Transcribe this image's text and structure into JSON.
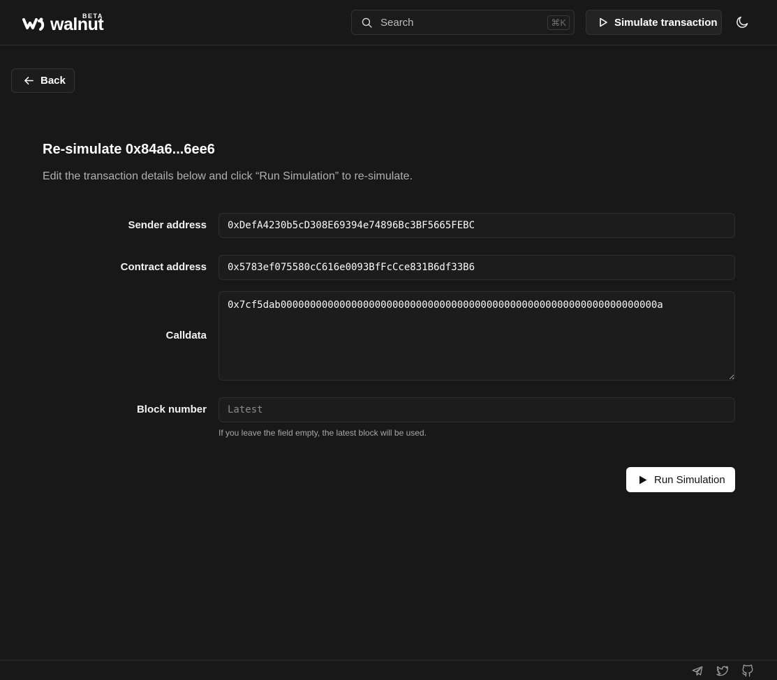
{
  "header": {
    "logo_text": "walnut",
    "logo_badge": "BETA",
    "search_placeholder": "Search",
    "search_shortcut": "⌘K",
    "simulate_button": "Simulate transaction",
    "theme_toggle_icon": "moon-icon"
  },
  "nav": {
    "back_label": "Back"
  },
  "page": {
    "title": "Re-simulate 0x84a6...6ee6",
    "subtitle": "Edit the transaction details below and click “Run Simulation” to re-simulate."
  },
  "form": {
    "sender": {
      "label": "Sender address",
      "value": "0xDefA4230b5cD308E69394e74896Bc3BF5665FEBC"
    },
    "contract": {
      "label": "Contract address",
      "value": "0x5783ef075580cC616e0093BfFcCce831B6df33B6"
    },
    "calldata": {
      "label": "Calldata",
      "value": "0x7cf5dab0000000000000000000000000000000000000000000000000000000000000000a"
    },
    "block": {
      "label": "Block number",
      "value": "",
      "placeholder": "Latest",
      "hint": "If you leave the field empty, the latest block will be used."
    },
    "run_button": "Run Simulation"
  },
  "footer": {
    "icons": [
      "telegram-icon",
      "twitter-icon",
      "github-icon"
    ]
  },
  "colors": {
    "background": "#181818",
    "text": "#f2f2f2",
    "muted": "#b0b0b0",
    "primary_button": "#ffffff"
  }
}
